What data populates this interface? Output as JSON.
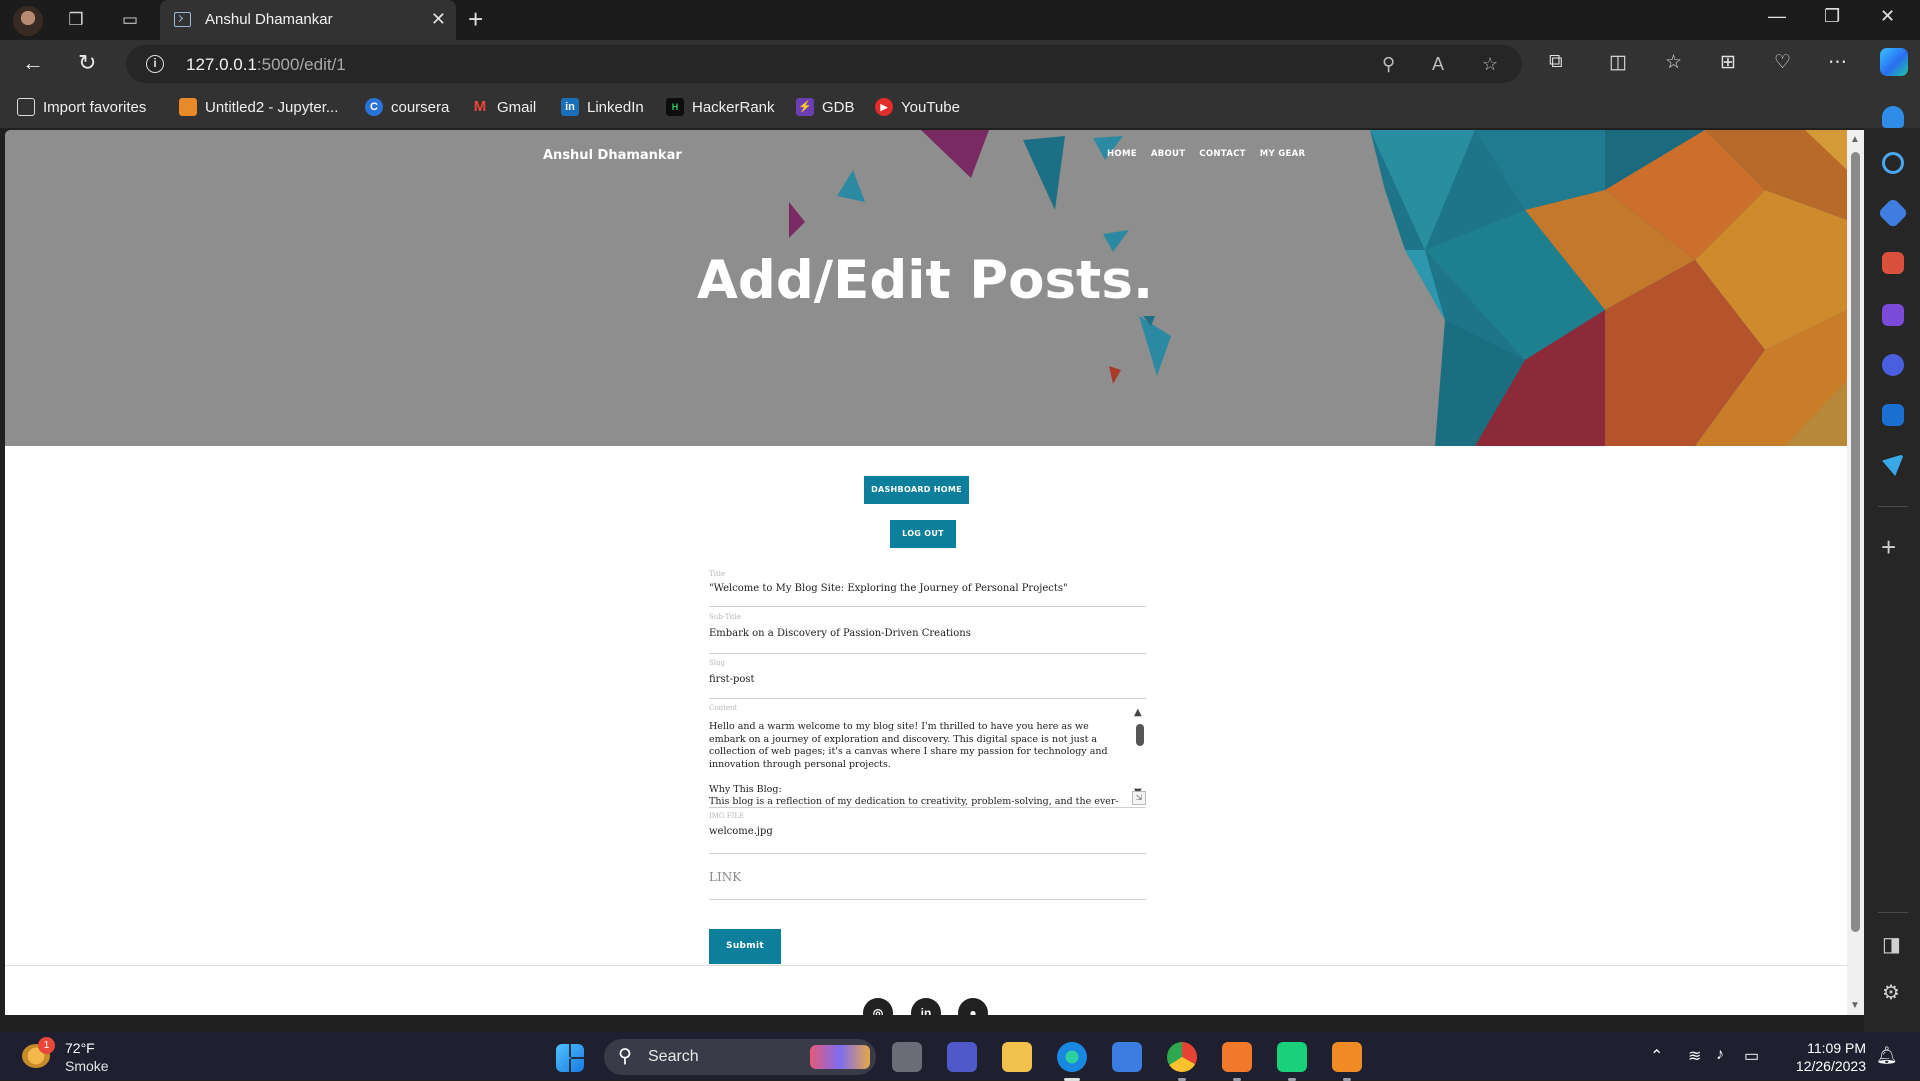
{
  "browser": {
    "tab_title": "Anshul Dhamankar",
    "url_host": "127.0.0.1",
    "url_path": ":5000/edit/1",
    "favorites": [
      {
        "label": "Import favorites",
        "icon": "import-icon"
      },
      {
        "label": "Untitled2 - Jupyter...",
        "icon": "jupyter-icon"
      },
      {
        "label": "coursera",
        "icon": "coursera-icon"
      },
      {
        "label": "Gmail",
        "icon": "gmail-icon"
      },
      {
        "label": "LinkedIn",
        "icon": "linkedin-icon"
      },
      {
        "label": "HackerRank",
        "icon": "hackerrank-icon"
      },
      {
        "label": "GDB",
        "icon": "gdb-icon"
      },
      {
        "label": "YouTube",
        "icon": "youtube-icon"
      }
    ]
  },
  "site": {
    "brand": "Anshul Dhamankar",
    "nav": [
      "HOME",
      "ABOUT",
      "CONTACT",
      "MY GEAR"
    ],
    "heading": "Add/Edit Posts.",
    "dashboard_button": "DASHBOARD HOME",
    "logout_button": "LOG OUT",
    "submit_button": "Submit",
    "accent_color": "#0b7f9b"
  },
  "form": {
    "title_label": "Title",
    "title_value": "\"Welcome to My Blog Site: Exploring the Journey of Personal Projects\"",
    "subtitle_label": "Sub-Title",
    "subtitle_value": "Embark on a Discovery of Passion-Driven Creations",
    "slug_label": "Slug",
    "slug_value": "first-post",
    "content_label": "Content",
    "content_p1": "Hello and a warm welcome to my blog site! I'm thrilled to have you here as we embark on a journey of exploration and discovery. This digital space is not just a collection of web pages; it's a canvas where I share my passion for technology and innovation through personal projects.",
    "content_p2_heading": "Why This Blog:",
    "content_p2": "This blog is a reflection of my dedication to creativity, problem-solving, and the ever-evolving world of technology. Each post you find here is a piece of me—crafted with",
    "img_label": "IMG FILE",
    "img_value": "welcome.jpg",
    "link_placeholder": "LINK"
  },
  "taskbar": {
    "weather_badge": "1",
    "temperature": "72°F",
    "condition": "Smoke",
    "search_label": "Search",
    "time": "11:09 PM",
    "date": "12/26/2023"
  }
}
